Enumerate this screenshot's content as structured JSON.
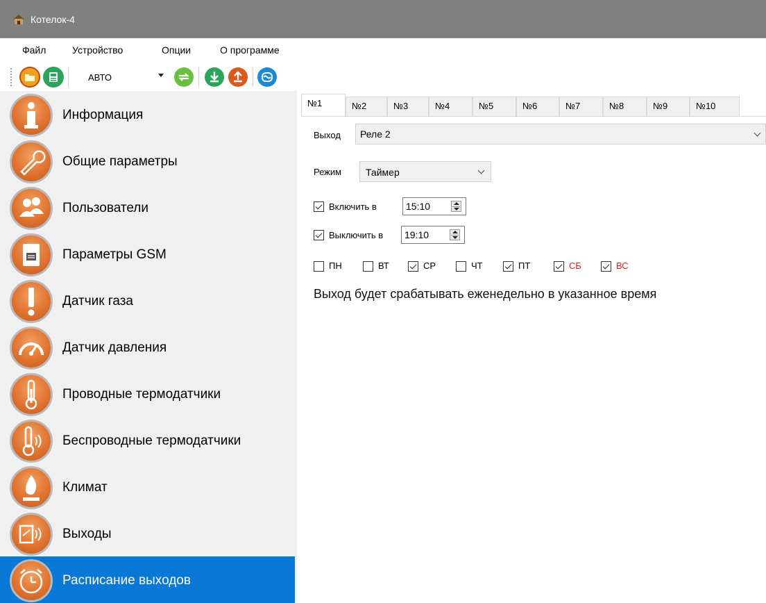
{
  "window": {
    "title": "Котелок-4",
    "icon": "house-icon"
  },
  "menu": {
    "items": [
      "Файл",
      "Устройство",
      "Опции",
      "О программе"
    ]
  },
  "toolbar": {
    "buttons": [
      {
        "name": "open-folder-icon",
        "color": "#f0a020"
      },
      {
        "name": "save-icon",
        "color": "#2aa55a"
      },
      {
        "name": "swap-icon",
        "color": "#68c040"
      },
      {
        "name": "download-icon",
        "color": "#2aa55a"
      },
      {
        "name": "upload-icon",
        "color": "#d85a1c"
      },
      {
        "name": "connect-icon",
        "color": "#1a8ad6"
      }
    ],
    "mode_combo": "АВТО"
  },
  "sidebar": {
    "items": [
      {
        "label": "Информация",
        "icon": "info-icon"
      },
      {
        "label": "Общие параметры",
        "icon": "wrench-icon"
      },
      {
        "label": "Пользователи",
        "icon": "users-icon"
      },
      {
        "label": "Параметры GSM",
        "icon": "sim-card-icon"
      },
      {
        "label": "Датчик газа",
        "icon": "exclamation-icon"
      },
      {
        "label": "Датчик давления",
        "icon": "gauge-icon"
      },
      {
        "label": "Проводные термодатчики",
        "icon": "thermometer-icon"
      },
      {
        "label": "Беспроводные термодатчики",
        "icon": "wireless-thermometer-icon"
      },
      {
        "label": "Климат",
        "icon": "flame-icon"
      },
      {
        "label": "Выходы",
        "icon": "relay-icon"
      },
      {
        "label": "Расписание выходов",
        "icon": "alarm-clock-icon"
      }
    ],
    "active_index": 10,
    "accent": "#0a78d7",
    "icon_color": "#e17330"
  },
  "tabs": [
    "№1",
    "№2",
    "№3",
    "№4",
    "№5",
    "№6",
    "№7",
    "№8",
    "№9",
    "№10"
  ],
  "active_tab": 0,
  "form": {
    "output_label": "Выход",
    "output_value": "Реле 2",
    "mode_label": "Режим",
    "mode_value": "Таймер",
    "on": {
      "label": "Включить в",
      "checked": true,
      "time": "15:10"
    },
    "off": {
      "label": "Выключить в",
      "checked": true,
      "time": "19:10"
    },
    "days": [
      {
        "label": "ПН",
        "checked": false,
        "weekend": false
      },
      {
        "label": "ВТ",
        "checked": false,
        "weekend": false
      },
      {
        "label": "СР",
        "checked": true,
        "weekend": false
      },
      {
        "label": "ЧТ",
        "checked": false,
        "weekend": false
      },
      {
        "label": "ПТ",
        "checked": true,
        "weekend": false
      },
      {
        "label": "СБ",
        "checked": true,
        "weekend": true
      },
      {
        "label": "ВС",
        "checked": true,
        "weekend": true
      }
    ],
    "info_text": "Выход будет срабатывать еженедельно в указанное время"
  }
}
